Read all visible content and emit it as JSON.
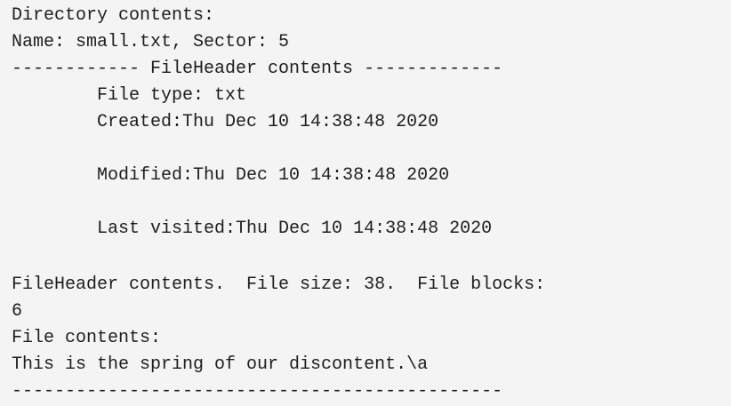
{
  "console": {
    "lines": [
      "Directory contents:",
      "Name: small.txt, Sector: 5",
      "------------ FileHeader contents -------------",
      "        File type: txt",
      "        Created:Thu Dec 10 14:38:48 2020",
      "",
      "        Modified:Thu Dec 10 14:38:48 2020",
      "",
      "        Last visited:Thu Dec 10 14:38:48 2020",
      "",
      "FileHeader contents.  File size: 38.  File blocks:",
      "6",
      "File contents:",
      "This is the spring of our discontent.\\a",
      "----------------------------------------------"
    ]
  }
}
